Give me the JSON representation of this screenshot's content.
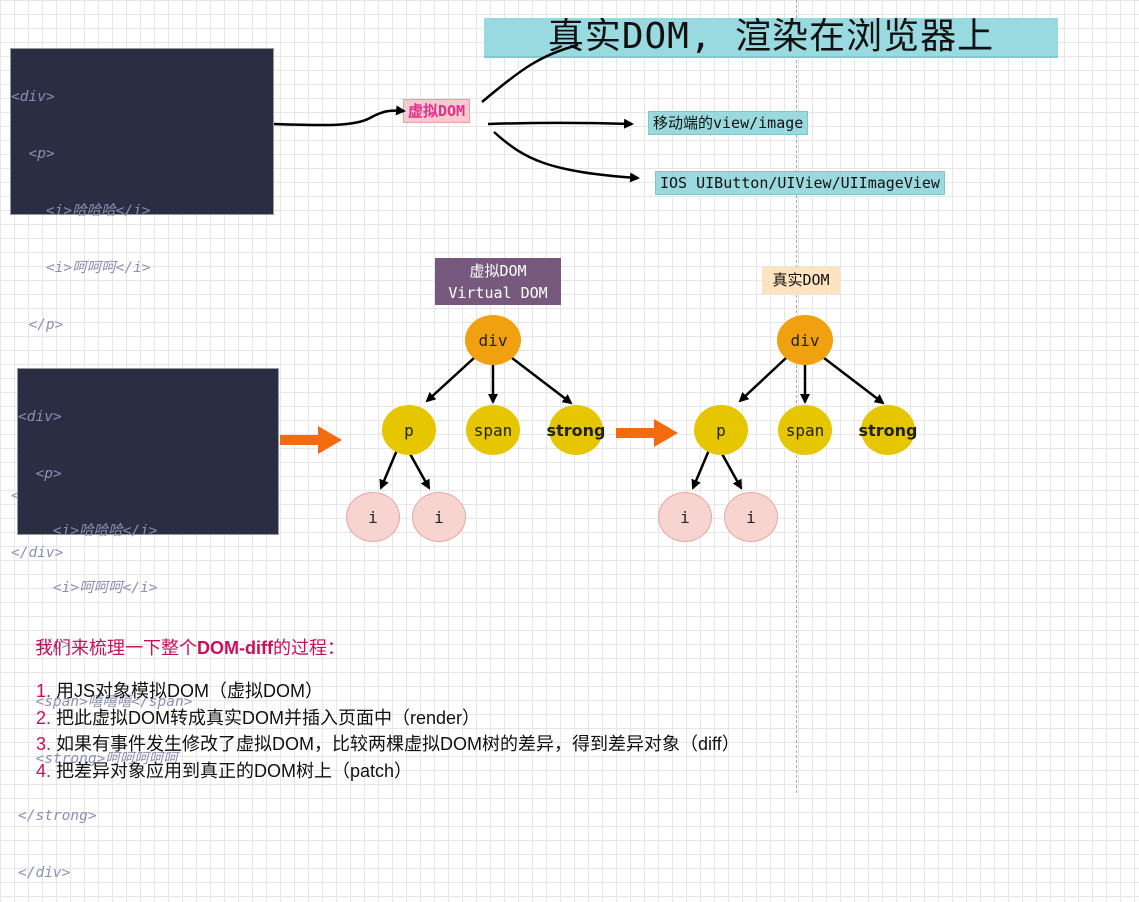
{
  "title": "真实DOM, 渲染在浏览器上",
  "code_lines": [
    "<div>",
    "  <p>",
    "    <i>哈哈哈</i>",
    "    <i>呵呵呵</i>",
    "  </p>",
    "  <span>嘻嘻嘻</span>",
    "  <strong>呵呵呵呵呵",
    "</strong>",
    "</div>"
  ],
  "top_flow": {
    "virtual_dom_tag": "虚拟DOM",
    "mobile_tag": "移动端的view/image",
    "ios_tag": "IOS UIButton/UIView/UIImageView"
  },
  "virtual_tree": {
    "label_line1": "虚拟DOM",
    "label_line2": "Virtual DOM",
    "root": "div",
    "children": [
      "p",
      "span",
      "strong"
    ],
    "grandchildren": [
      "i",
      "i"
    ]
  },
  "real_tree": {
    "label": "真实DOM",
    "root": "div",
    "children": [
      "p",
      "span",
      "strong"
    ],
    "grandchildren": [
      "i",
      "i"
    ]
  },
  "notes": {
    "heading_prefix": "我们来梳理一下整个",
    "heading_bold": "DOM-diff",
    "heading_suffix": "的过程：",
    "items": [
      {
        "num": "1.",
        "text": " 用JS对象模拟DOM（虚拟DOM）"
      },
      {
        "num": "2.",
        "text": " 把此虚拟DOM转成真实DOM并插入页面中（render）"
      },
      {
        "num": "3.",
        "text": " 如果有事件发生修改了虚拟DOM，比较两棵虚拟DOM树的差异，得到差异对象（diff）"
      },
      {
        "num": "4.",
        "text": " 把差异对象应用到真正的DOM树上（patch）"
      }
    ]
  },
  "colors": {
    "code_bg": "#2b2d42",
    "root_node": "#f1a10f",
    "mid_node": "#e5c600",
    "leaf_node": "#f8d4d0",
    "arrow_orange": "#f26b0f",
    "accent_text": "#c8105a"
  }
}
